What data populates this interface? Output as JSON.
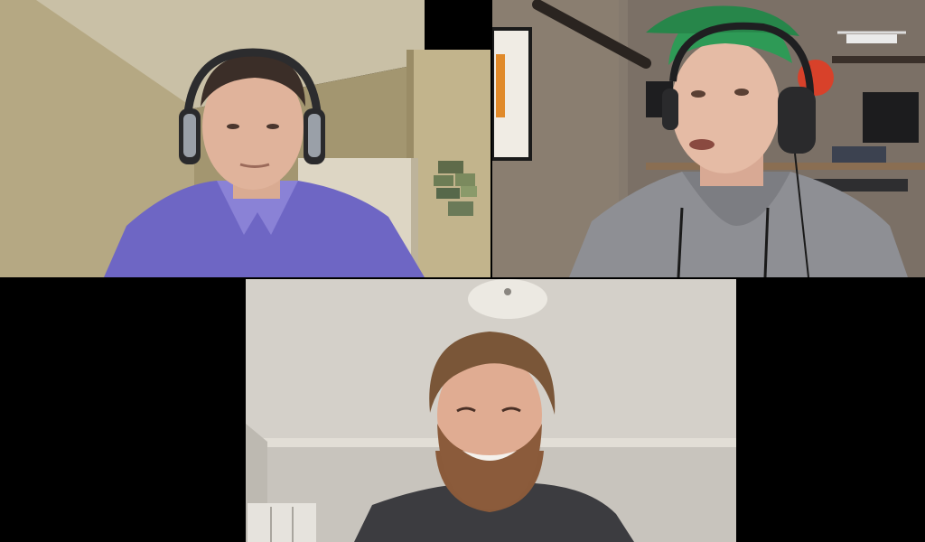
{
  "meeting": {
    "layout": "gallery",
    "participants": [
      {
        "id": "p1",
        "video": "on",
        "headphones": true,
        "shirt_color": "#6f66c8"
      },
      {
        "id": "p2",
        "video": "on",
        "headphones": true,
        "cap_color": "#2e9a56"
      },
      {
        "id": "p3",
        "video": "on",
        "headphones": false,
        "shirt_color": "#3a3a3e"
      }
    ]
  },
  "colors": {
    "background": "#000000",
    "wall_tile1": "#b3a782",
    "wall_tile2": "#857a6d",
    "wall_tile3": "#cfcbc4"
  }
}
